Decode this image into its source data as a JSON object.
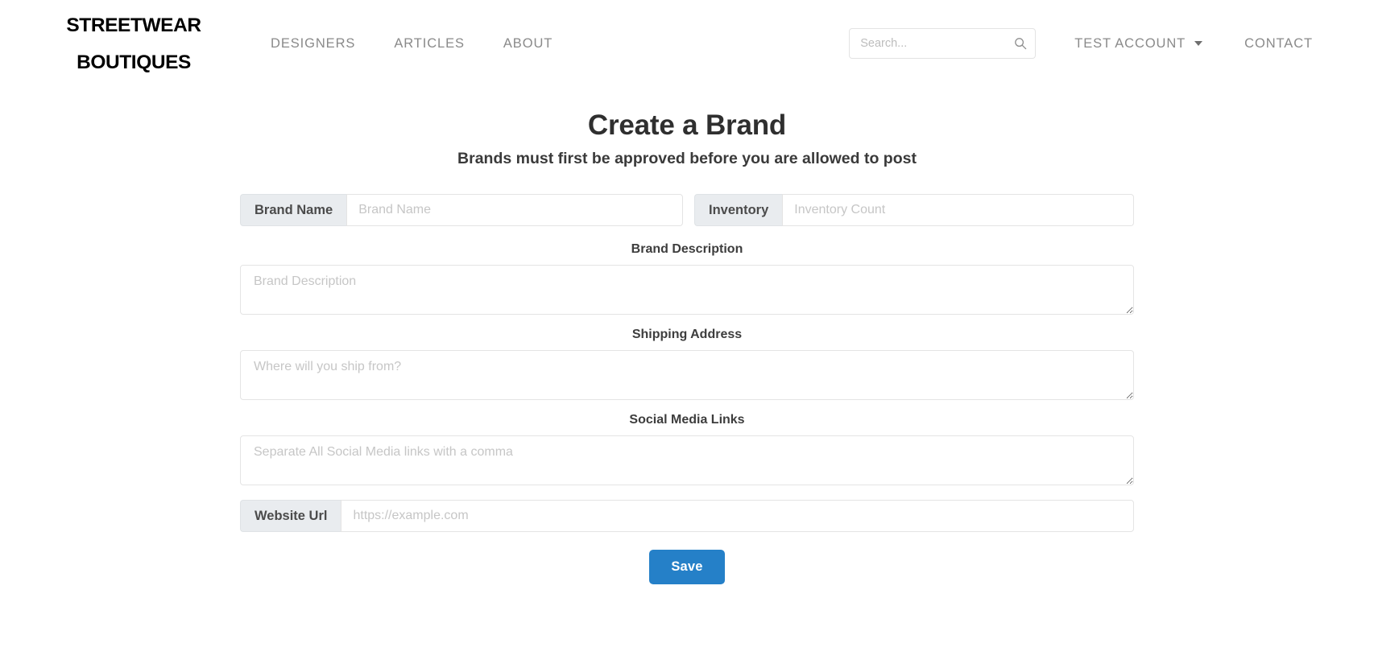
{
  "header": {
    "logo_line1": "STREETWEAR",
    "logo_line2": "BOUTIQUES",
    "nav": [
      {
        "label": "DESIGNERS"
      },
      {
        "label": "ARTICLES"
      },
      {
        "label": "ABOUT"
      }
    ],
    "search": {
      "placeholder": "Search...",
      "value": "",
      "icon": "search-icon"
    },
    "account": {
      "label": "TEST ACCOUNT",
      "caret_icon": "chevron-down-icon"
    },
    "contact": {
      "label": "CONTACT"
    }
  },
  "main": {
    "title": "Create a Brand",
    "subtitle": "Brands must first be approved before you are allowed to post",
    "fields": {
      "brand_name": {
        "prefix": "Brand Name",
        "placeholder": "Brand Name",
        "value": ""
      },
      "inventory": {
        "prefix": "Inventory",
        "placeholder": "Inventory Count",
        "value": ""
      },
      "brand_description": {
        "label": "Brand Description",
        "placeholder": "Brand Description",
        "value": ""
      },
      "shipping_address": {
        "label": "Shipping Address",
        "placeholder": "Where will you ship from?",
        "value": ""
      },
      "social_media_links": {
        "label": "Social Media Links",
        "placeholder": "Separate All Social Media links with a comma",
        "value": ""
      },
      "website_url": {
        "prefix": "Website Url",
        "placeholder": "https://example.com",
        "value": ""
      }
    },
    "save_button": {
      "label": "Save"
    }
  },
  "colors": {
    "accent_blue": "#2580c8",
    "nav_gray": "#8a8a8a",
    "prefix_bg": "#e9ecef",
    "border": "#e4e4e4",
    "text_dark": "#2f2f2f"
  }
}
